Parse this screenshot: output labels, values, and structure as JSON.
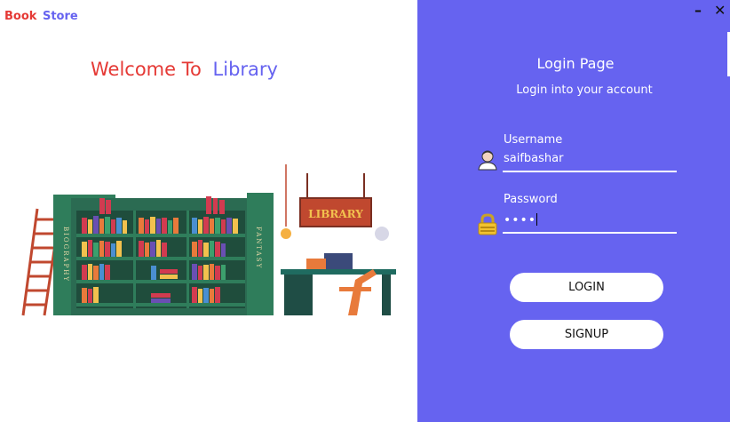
{
  "brand": {
    "word1": "Book",
    "word2": "Store"
  },
  "welcome": {
    "word1": "Welcome To",
    "word2": "Library"
  },
  "window_controls": {
    "minimize": "–",
    "close": "✕"
  },
  "illustration": {
    "sign_text": "LIBRARY",
    "shelf_left_label": "BIOGRAPHY",
    "shelf_right_label": "FANTASY"
  },
  "login": {
    "title": "Login Page",
    "subtitle": "Login into your account",
    "username_label": "Username",
    "username_value": "saifbashar",
    "password_label": "Password",
    "password_mask": "••••",
    "login_button": "LOGIN",
    "signup_button": "SIGNUP"
  },
  "colors": {
    "accent_red": "#e53935",
    "accent_purple": "#6663f0",
    "panel_bg": "#6663f0",
    "text_on_panel": "#ffffff"
  },
  "icons": {
    "username": "user-avatar-icon",
    "password": "padlock-icon"
  }
}
